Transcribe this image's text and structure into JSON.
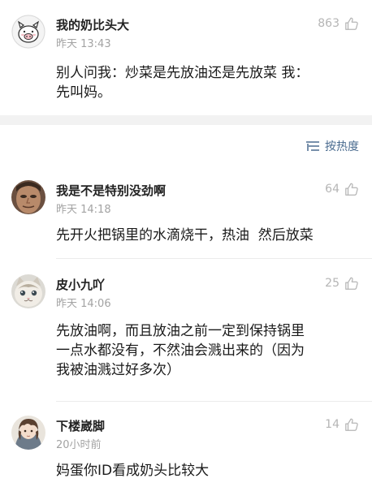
{
  "comments": [
    {
      "user": "我的奶比头大",
      "time": "昨天 13:43",
      "likes": "863",
      "text": "别人问我：炒菜是先放油还是先放菜 我：\n先叫妈。"
    },
    {
      "user": "我是不是特别没劲啊",
      "time": "昨天 14:18",
      "likes": "64",
      "text": "先开火把锅里的水滴烧干，热油  然后放菜"
    },
    {
      "user": "皮小九吖",
      "time": "昨天 14:06",
      "likes": "25",
      "text": "先放油啊，而且放油之前一定到保持锅里\n一点水都没有，不然油会溅出来的（因为\n我被油溅过好多次）"
    },
    {
      "user": "下楼崴脚",
      "time": "20小时前",
      "likes": "14",
      "text": "妈蛋你ID看成奶头比较大"
    }
  ],
  "sort": {
    "label": "按热度",
    "icon": "sort-lines-icon"
  },
  "icons": {
    "like": "thumbs-up-icon"
  },
  "colors": {
    "accent": "#4a6b8f",
    "muted": "#a3a3a3",
    "band": "#f2f2f2"
  }
}
